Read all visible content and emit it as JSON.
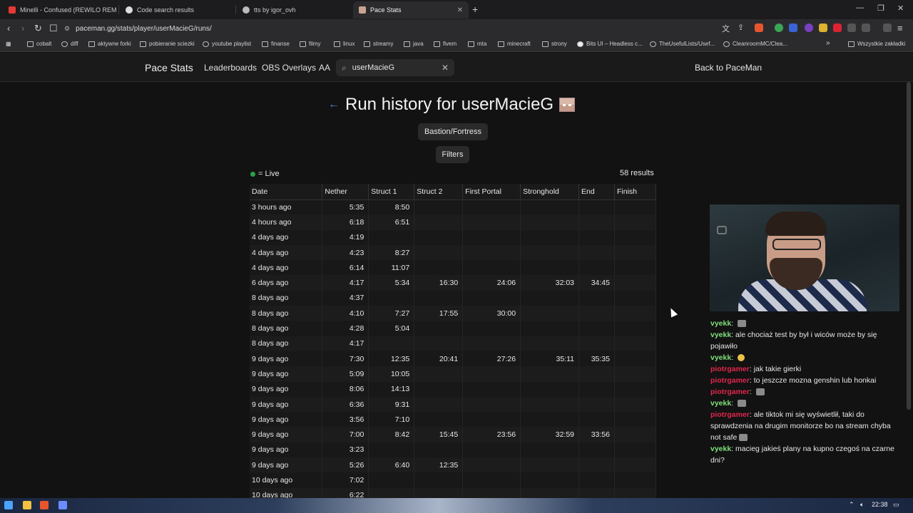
{
  "browser": {
    "tabs": [
      {
        "title": "Minelli - Confused (REWILO REMI",
        "fav_color": "#e53935"
      },
      {
        "title": "Code search results",
        "fav_color": "#dddddd"
      },
      {
        "title": "tts by igor_ovh",
        "fav_color": "#bbbbbb"
      },
      {
        "title": "Pace Stats",
        "fav_color": "#c9a38e",
        "active": true
      }
    ],
    "new_tab": "+",
    "url": "paceman.gg/stats/player/userMacieG/runs/",
    "bookmarks": [
      "cobalt",
      "diff",
      "aktywne forki",
      "pobieranie sciezki",
      "youtube playlist",
      "finanse",
      "filmy",
      "linux",
      "streamy",
      "java",
      "fivem",
      "mta",
      "minecraft",
      "strony",
      "Bits UI – Headless c...",
      "TheUsefulLists/Usef...",
      "CleanroomMC/Clea..."
    ],
    "bookmarks_overflow": "»",
    "all_bookmarks": "Wszystkie zakładki"
  },
  "site": {
    "brand": "Pace Stats",
    "nav": [
      "Leaderboards",
      "OBS Overlays",
      "AA"
    ],
    "search_value": "userMacieG",
    "back_link": "Back to PaceMan"
  },
  "page": {
    "title": "Run history for userMacieG",
    "category": "Bastion/Fortress",
    "filters": "Filters",
    "live_legend": "= Live",
    "results": "58 results"
  },
  "table": {
    "headers": [
      "Date",
      "Nether",
      "Struct 1",
      "Struct 2",
      "First Portal",
      "Stronghold",
      "End",
      "Finish"
    ],
    "rows": [
      [
        "3 hours ago",
        "5:35",
        "8:50",
        "",
        "",
        "",
        "",
        ""
      ],
      [
        "4 hours ago",
        "6:18",
        "6:51",
        "",
        "",
        "",
        "",
        ""
      ],
      [
        "4 days ago",
        "4:19",
        "",
        "",
        "",
        "",
        "",
        ""
      ],
      [
        "4 days ago",
        "4:23",
        "8:27",
        "",
        "",
        "",
        "",
        ""
      ],
      [
        "4 days ago",
        "6:14",
        "11:07",
        "",
        "",
        "",
        "",
        ""
      ],
      [
        "6 days ago",
        "4:17",
        "5:34",
        "16:30",
        "24:06",
        "32:03",
        "34:45",
        ""
      ],
      [
        "8 days ago",
        "4:37",
        "",
        "",
        "",
        "",
        "",
        ""
      ],
      [
        "8 days ago",
        "4:10",
        "7:27",
        "17:55",
        "30:00",
        "",
        "",
        ""
      ],
      [
        "8 days ago",
        "4:28",
        "5:04",
        "",
        "",
        "",
        "",
        ""
      ],
      [
        "8 days ago",
        "4:17",
        "",
        "",
        "",
        "",
        "",
        ""
      ],
      [
        "9 days ago",
        "7:30",
        "12:35",
        "20:41",
        "27:26",
        "35:11",
        "35:35",
        ""
      ],
      [
        "9 days ago",
        "5:09",
        "10:05",
        "",
        "",
        "",
        "",
        ""
      ],
      [
        "9 days ago",
        "8:06",
        "14:13",
        "",
        "",
        "",
        "",
        ""
      ],
      [
        "9 days ago",
        "6:36",
        "9:31",
        "",
        "",
        "",
        "",
        ""
      ],
      [
        "9 days ago",
        "3:56",
        "7:10",
        "",
        "",
        "",
        "",
        ""
      ],
      [
        "9 days ago",
        "7:00",
        "8:42",
        "15:45",
        "23:56",
        "32:59",
        "33:56",
        ""
      ],
      [
        "9 days ago",
        "3:23",
        "",
        "",
        "",
        "",
        "",
        ""
      ],
      [
        "9 days ago",
        "5:26",
        "6:40",
        "12:35",
        "",
        "",
        "",
        ""
      ],
      [
        "10 days ago",
        "7:02",
        "",
        "",
        "",
        "",
        "",
        ""
      ],
      [
        "10 days ago",
        "6:22",
        "",
        "",
        "",
        "",
        "",
        ""
      ]
    ]
  },
  "chat": [
    {
      "user": "vyekk",
      "color": "green",
      "text": "",
      "emote": "grey"
    },
    {
      "user": "vyekk",
      "color": "green",
      "text": "ale chociaż test by był i wiców może by się pojawiło"
    },
    {
      "user": "vyekk",
      "color": "green",
      "text": "",
      "emote": "yellow"
    },
    {
      "user": "piotrgamer",
      "color": "red",
      "text": "jak takie gierki"
    },
    {
      "user": "piotrgamer",
      "color": "red",
      "text": "to jeszcze mozna genshin lub honkai"
    },
    {
      "user": "piotrgamer",
      "color": "red",
      "text": "",
      "emote": "grey"
    },
    {
      "user": "vyekk",
      "color": "green",
      "text": "",
      "emote": "grey"
    },
    {
      "user": "piotrgamer",
      "color": "red",
      "text": "ale tiktok mi się wyświetlił, taki do sprawdzenia na drugim monitorze bo na stream chyba not safe",
      "emote": "grey"
    },
    {
      "user": "vyekk",
      "color": "green",
      "text": "macieg jakieś plany na kupno czegoś na czarne dni?"
    }
  ],
  "taskbar": {
    "time": "22:38"
  }
}
